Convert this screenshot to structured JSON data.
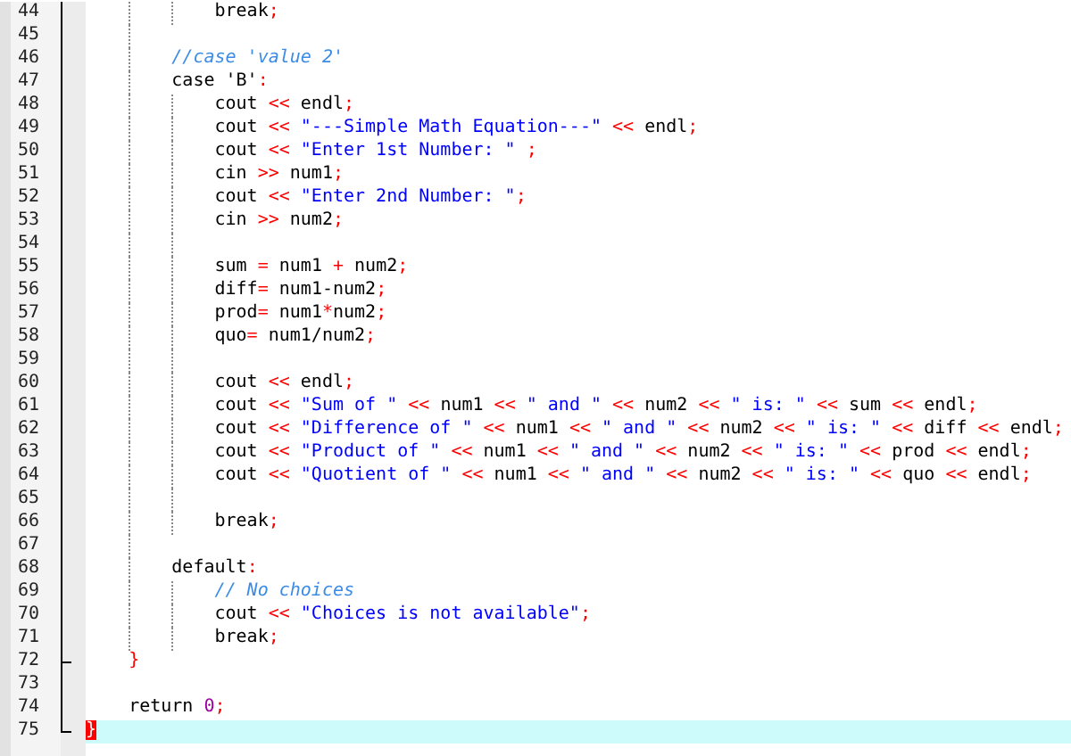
{
  "editor": {
    "lines": [
      {
        "number": "44",
        "kind": "statement",
        "tokens": [
          {
            "kind": "keyword",
            "text": "break"
          },
          {
            "kind": "op",
            "text": ";"
          }
        ],
        "current": false
      },
      {
        "number": "45",
        "kind": "label",
        "current": false
      },
      {
        "number": "46",
        "kind": "label",
        "tokens": [
          {
            "kind": "comment",
            "text": "//case 'value 2'"
          }
        ],
        "current": false
      },
      {
        "number": "47",
        "kind": "label",
        "tokens": [
          {
            "kind": "keyword",
            "text": "case"
          },
          {
            "kind": "plain",
            "text": " 'B'"
          },
          {
            "kind": "op",
            "text": ":"
          }
        ],
        "current": false
      },
      {
        "number": "48",
        "kind": "statement",
        "tokens": [
          {
            "kind": "plain",
            "text": "cout "
          },
          {
            "kind": "op",
            "text": "<<"
          },
          {
            "kind": "plain",
            "text": " endl"
          },
          {
            "kind": "op",
            "text": ";"
          }
        ],
        "current": false
      },
      {
        "number": "49",
        "kind": "statement",
        "tokens": [
          {
            "kind": "plain",
            "text": "cout "
          },
          {
            "kind": "op",
            "text": "<< "
          },
          {
            "kind": "string",
            "text": "\"---Simple Math Equation---\" "
          },
          {
            "kind": "op",
            "text": "<<"
          },
          {
            "kind": "plain",
            "text": " endl"
          },
          {
            "kind": "op",
            "text": ";"
          }
        ],
        "current": false
      },
      {
        "number": "50",
        "kind": "statement",
        "tokens": [
          {
            "kind": "plain",
            "text": "cout "
          },
          {
            "kind": "op",
            "text": "<< "
          },
          {
            "kind": "string",
            "text": "\"Enter 1st Number: \" "
          },
          {
            "kind": "op",
            "text": ";"
          }
        ],
        "current": false
      },
      {
        "number": "51",
        "kind": "statement",
        "tokens": [
          {
            "kind": "plain",
            "text": "cin "
          },
          {
            "kind": "op",
            "text": ">>"
          },
          {
            "kind": "plain",
            "text": " num1"
          },
          {
            "kind": "op",
            "text": ";"
          }
        ],
        "current": false
      },
      {
        "number": "52",
        "kind": "statement",
        "tokens": [
          {
            "kind": "plain",
            "text": "cout "
          },
          {
            "kind": "op",
            "text": "<< "
          },
          {
            "kind": "string",
            "text": "\"Enter 2nd Number: \""
          },
          {
            "kind": "op",
            "text": ";"
          }
        ],
        "current": false
      },
      {
        "number": "53",
        "kind": "statement",
        "tokens": [
          {
            "kind": "plain",
            "text": "cin "
          },
          {
            "kind": "op",
            "text": ">>"
          },
          {
            "kind": "plain",
            "text": " num2"
          },
          {
            "kind": "op",
            "text": ";"
          }
        ],
        "current": false
      },
      {
        "number": "54",
        "kind": "statement",
        "current": false
      },
      {
        "number": "55",
        "kind": "statement",
        "tokens": [
          {
            "kind": "plain",
            "text": "sum "
          },
          {
            "kind": "op",
            "text": "="
          },
          {
            "kind": "plain",
            "text": " num1 "
          },
          {
            "kind": "op",
            "text": "+"
          },
          {
            "kind": "plain",
            "text": " num2"
          },
          {
            "kind": "op",
            "text": ";"
          }
        ],
        "current": false
      },
      {
        "number": "56",
        "kind": "statement",
        "tokens": [
          {
            "kind": "plain",
            "text": "diff"
          },
          {
            "kind": "op",
            "text": "="
          },
          {
            "kind": "plain",
            "text": " num1-num2"
          },
          {
            "kind": "op",
            "text": ";"
          }
        ],
        "current": false
      },
      {
        "number": "57",
        "kind": "statement",
        "tokens": [
          {
            "kind": "plain",
            "text": "prod"
          },
          {
            "kind": "op",
            "text": "="
          },
          {
            "kind": "plain",
            "text": " num1"
          },
          {
            "kind": "op",
            "text": "*"
          },
          {
            "kind": "plain",
            "text": "num2"
          },
          {
            "kind": "op",
            "text": ";"
          }
        ],
        "current": false
      },
      {
        "number": "58",
        "kind": "statement",
        "tokens": [
          {
            "kind": "plain",
            "text": "quo"
          },
          {
            "kind": "op",
            "text": "="
          },
          {
            "kind": "plain",
            "text": " num1/num2"
          },
          {
            "kind": "op",
            "text": ";"
          }
        ],
        "current": false
      },
      {
        "number": "59",
        "kind": "statement",
        "current": false
      },
      {
        "number": "60",
        "kind": "statement",
        "tokens": [
          {
            "kind": "plain",
            "text": "cout "
          },
          {
            "kind": "op",
            "text": "<<"
          },
          {
            "kind": "plain",
            "text": " endl"
          },
          {
            "kind": "op",
            "text": ";"
          }
        ],
        "current": false
      },
      {
        "number": "61",
        "kind": "statement",
        "tokens": [
          {
            "kind": "plain",
            "text": "cout "
          },
          {
            "kind": "op",
            "text": "<< "
          },
          {
            "kind": "string",
            "text": "\"Sum of \" "
          },
          {
            "kind": "op",
            "text": "<<"
          },
          {
            "kind": "plain",
            "text": " num1 "
          },
          {
            "kind": "op",
            "text": "<< "
          },
          {
            "kind": "string",
            "text": "\" and \" "
          },
          {
            "kind": "op",
            "text": "<<"
          },
          {
            "kind": "plain",
            "text": " num2 "
          },
          {
            "kind": "op",
            "text": "<< "
          },
          {
            "kind": "string",
            "text": "\" is: \" "
          },
          {
            "kind": "op",
            "text": "<<"
          },
          {
            "kind": "plain",
            "text": " sum "
          },
          {
            "kind": "op",
            "text": "<<"
          },
          {
            "kind": "plain",
            "text": " endl"
          },
          {
            "kind": "op",
            "text": ";"
          }
        ],
        "current": false
      },
      {
        "number": "62",
        "kind": "statement",
        "tokens": [
          {
            "kind": "plain",
            "text": "cout "
          },
          {
            "kind": "op",
            "text": "<< "
          },
          {
            "kind": "string",
            "text": "\"Difference of \" "
          },
          {
            "kind": "op",
            "text": "<<"
          },
          {
            "kind": "plain",
            "text": " num1 "
          },
          {
            "kind": "op",
            "text": "<< "
          },
          {
            "kind": "string",
            "text": "\" and \" "
          },
          {
            "kind": "op",
            "text": "<<"
          },
          {
            "kind": "plain",
            "text": " num2 "
          },
          {
            "kind": "op",
            "text": "<< "
          },
          {
            "kind": "string",
            "text": "\" is: \" "
          },
          {
            "kind": "op",
            "text": "<<"
          },
          {
            "kind": "plain",
            "text": " diff "
          },
          {
            "kind": "op",
            "text": "<<"
          },
          {
            "kind": "plain",
            "text": " endl"
          },
          {
            "kind": "op",
            "text": ";"
          }
        ],
        "current": false
      },
      {
        "number": "63",
        "kind": "statement",
        "tokens": [
          {
            "kind": "plain",
            "text": "cout "
          },
          {
            "kind": "op",
            "text": "<< "
          },
          {
            "kind": "string",
            "text": "\"Product of \" "
          },
          {
            "kind": "op",
            "text": "<<"
          },
          {
            "kind": "plain",
            "text": " num1 "
          },
          {
            "kind": "op",
            "text": "<< "
          },
          {
            "kind": "string",
            "text": "\" and \" "
          },
          {
            "kind": "op",
            "text": "<<"
          },
          {
            "kind": "plain",
            "text": " num2 "
          },
          {
            "kind": "op",
            "text": "<< "
          },
          {
            "kind": "string",
            "text": "\" is: \" "
          },
          {
            "kind": "op",
            "text": "<<"
          },
          {
            "kind": "plain",
            "text": " prod "
          },
          {
            "kind": "op",
            "text": "<<"
          },
          {
            "kind": "plain",
            "text": " endl"
          },
          {
            "kind": "op",
            "text": ";"
          }
        ],
        "current": false
      },
      {
        "number": "64",
        "kind": "statement",
        "tokens": [
          {
            "kind": "plain",
            "text": "cout "
          },
          {
            "kind": "op",
            "text": "<< "
          },
          {
            "kind": "string",
            "text": "\"Quotient of \" "
          },
          {
            "kind": "op",
            "text": "<<"
          },
          {
            "kind": "plain",
            "text": " num1 "
          },
          {
            "kind": "op",
            "text": "<< "
          },
          {
            "kind": "string",
            "text": "\" and \" "
          },
          {
            "kind": "op",
            "text": "<<"
          },
          {
            "kind": "plain",
            "text": " num2 "
          },
          {
            "kind": "op",
            "text": "<< "
          },
          {
            "kind": "string",
            "text": "\" is: \" "
          },
          {
            "kind": "op",
            "text": "<<"
          },
          {
            "kind": "plain",
            "text": " quo "
          },
          {
            "kind": "op",
            "text": "<<"
          },
          {
            "kind": "plain",
            "text": " endl"
          },
          {
            "kind": "op",
            "text": ";"
          }
        ],
        "current": false
      },
      {
        "number": "65",
        "kind": "statement",
        "current": false
      },
      {
        "number": "66",
        "kind": "statement",
        "tokens": [
          {
            "kind": "keyword",
            "text": "break"
          },
          {
            "kind": "op",
            "text": ";"
          }
        ],
        "current": false
      },
      {
        "number": "67",
        "kind": "label",
        "current": false
      },
      {
        "number": "68",
        "kind": "label",
        "tokens": [
          {
            "kind": "keyword",
            "text": "default"
          },
          {
            "kind": "op",
            "text": ":"
          }
        ],
        "current": false
      },
      {
        "number": "69",
        "kind": "statement",
        "tokens": [
          {
            "kind": "comment",
            "text": "// No choices"
          }
        ],
        "current": false
      },
      {
        "number": "70",
        "kind": "statement",
        "tokens": [
          {
            "kind": "plain",
            "text": "cout "
          },
          {
            "kind": "op",
            "text": "<< "
          },
          {
            "kind": "string",
            "text": "\"Choices is not available\""
          },
          {
            "kind": "op",
            "text": ";"
          }
        ],
        "current": false
      },
      {
        "number": "71",
        "kind": "statement",
        "tokens": [
          {
            "kind": "keyword",
            "text": "break"
          },
          {
            "kind": "op",
            "text": ";"
          }
        ],
        "current": false
      },
      {
        "number": "72",
        "kind": "block",
        "tokens": [
          {
            "kind": "op",
            "text": "}"
          }
        ],
        "current": false,
        "fold_end": true
      },
      {
        "number": "73",
        "kind": "block",
        "current": false
      },
      {
        "number": "74",
        "kind": "block",
        "tokens": [
          {
            "kind": "keyword",
            "text": "return "
          },
          {
            "kind": "number",
            "text": "0"
          },
          {
            "kind": "op",
            "text": ";"
          }
        ],
        "current": false
      },
      {
        "number": "75",
        "kind": "top",
        "tokens": [
          {
            "kind": "brace_match",
            "text": "}"
          }
        ],
        "current": true,
        "fold_end": true
      }
    ]
  }
}
